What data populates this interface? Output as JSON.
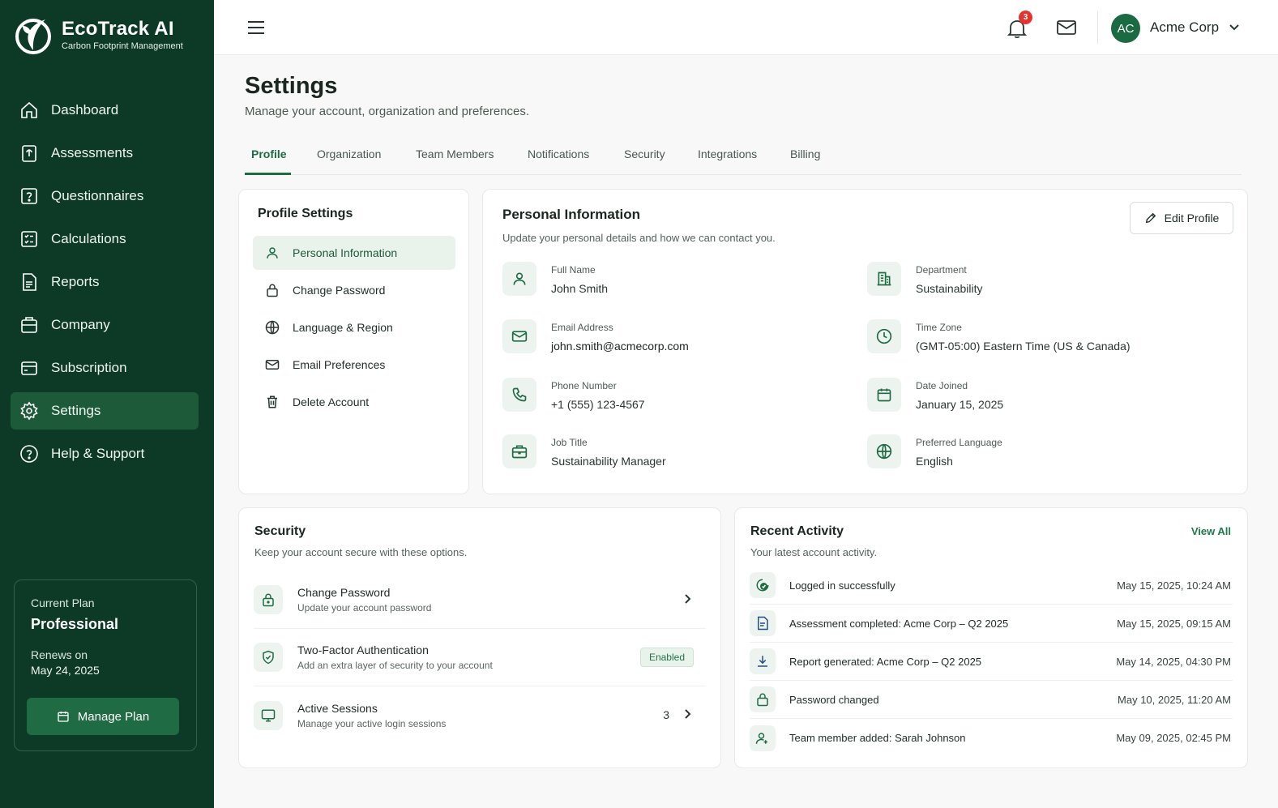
{
  "brand": {
    "title": "EcoTrack AI",
    "subtitle": "Carbon Footprint Management",
    "logo_icon": "leaf-logo-icon"
  },
  "sidebar": {
    "items": [
      {
        "label": "Dashboard",
        "icon": "home-icon"
      },
      {
        "label": "Assessments",
        "icon": "clipboard-icon"
      },
      {
        "label": "Questionnaires",
        "icon": "question-icon"
      },
      {
        "label": "Calculations",
        "icon": "checklist-icon"
      },
      {
        "label": "Reports",
        "icon": "report-icon"
      },
      {
        "label": "Company",
        "icon": "company-icon"
      },
      {
        "label": "Subscription",
        "icon": "card-icon"
      },
      {
        "label": "Settings",
        "icon": "gear-icon",
        "active": true
      },
      {
        "label": "Help & Support",
        "icon": "help-icon"
      }
    ],
    "plan": {
      "label": "Current Plan",
      "name": "Professional",
      "renews_label": "Renews on",
      "renews_date": "May 24, 2025",
      "button": "Manage Plan"
    }
  },
  "topbar": {
    "notification_count": "3",
    "avatar_initials": "AC",
    "company": "Acme Corp"
  },
  "page": {
    "title": "Settings",
    "subtitle": "Manage your account, organization and preferences."
  },
  "tabs": [
    "Profile",
    "Organization",
    "Team Members",
    "Notifications",
    "Security",
    "Integrations",
    "Billing"
  ],
  "profile_settings": {
    "title": "Profile Settings",
    "items": [
      {
        "label": "Personal Information",
        "icon": "user-icon",
        "active": true
      },
      {
        "label": "Change Password",
        "icon": "lock-icon"
      },
      {
        "label": "Language & Region",
        "icon": "globe-icon"
      },
      {
        "label": "Email Preferences",
        "icon": "mail-icon"
      },
      {
        "label": "Delete Account",
        "icon": "trash-icon"
      }
    ]
  },
  "personal_info": {
    "title": "Personal Information",
    "subtitle": "Update your personal details and how we can contact you.",
    "edit_button": "Edit Profile",
    "fields": [
      {
        "label": "Full Name",
        "value": "John Smith",
        "icon": "user-icon"
      },
      {
        "label": "Department",
        "value": "Sustainability",
        "icon": "building-icon"
      },
      {
        "label": "Email Address",
        "value": "john.smith@acmecorp.com",
        "icon": "mail-icon"
      },
      {
        "label": "Time Zone",
        "value": "(GMT-05:00) Eastern Time (US & Canada)",
        "icon": "clock-icon"
      },
      {
        "label": "Phone Number",
        "value": "+1 (555) 123-4567",
        "icon": "phone-icon"
      },
      {
        "label": "Date Joined",
        "value": "January 15, 2025",
        "icon": "calendar-icon"
      },
      {
        "label": "Job Title",
        "value": "Sustainability Manager",
        "icon": "briefcase-icon"
      },
      {
        "label": "Preferred Language",
        "value": "English",
        "icon": "globe-icon"
      }
    ]
  },
  "security": {
    "title": "Security",
    "subtitle": "Keep your account secure with these options.",
    "rows": [
      {
        "title": "Change Password",
        "desc": "Update your account password",
        "icon": "lock-icon"
      },
      {
        "title": "Two-Factor Authentication",
        "desc": "Add an extra layer of security to your account",
        "icon": "shield-icon",
        "badge": "Enabled"
      },
      {
        "title": "Active Sessions",
        "desc": "Manage your active login sessions",
        "icon": "monitor-icon",
        "count": "3"
      }
    ]
  },
  "activity": {
    "title": "Recent Activity",
    "subtitle": "Your latest account activity.",
    "view_all": "View All",
    "items": [
      {
        "text": "Logged in successfully",
        "time": "May 15, 2025, 10:24 AM",
        "icon": "login-icon"
      },
      {
        "text": "Assessment completed: Acme Corp – Q2 2025",
        "time": "May 15, 2025, 09:15 AM",
        "icon": "document-icon"
      },
      {
        "text": "Report generated: Acme Corp – Q2 2025",
        "time": "May 14, 2025, 04:30 PM",
        "icon": "download-icon"
      },
      {
        "text": "Password changed",
        "time": "May 10, 2025, 11:20 AM",
        "icon": "lock-icon"
      },
      {
        "text": "Team member added: Sarah Johnson",
        "time": "May 09, 2025, 02:45 PM",
        "icon": "user-add-icon"
      }
    ]
  },
  "colors": {
    "sidebar_bg": "#0d3a26",
    "accent": "#1f6b44",
    "active_nav": "#1c5a3a",
    "badge_red": "#e5342f"
  }
}
